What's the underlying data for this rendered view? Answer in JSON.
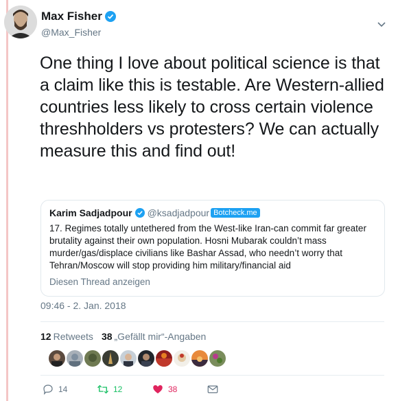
{
  "author": {
    "name": "Max Fisher",
    "handle": "@Max_Fisher"
  },
  "tweet": {
    "text": "One thing I love about political science is that a claim like this is testable. Are Western-allied countries less likely to cross certain violence threshholders vs protesters? We can actually measure this and find out!",
    "timestamp": "09:46 - 2. Jan. 2018"
  },
  "quoted": {
    "name": "Karim Sadjadpour",
    "handle": "@ksadjadpour",
    "badge": "Botcheck.me",
    "text": "17. Regimes totally untethered from the West-like Iran-can commit far greater brutality against their own population. Hosni Mubarak couldn’t mass murder/gas/displace civilians like Bashar Assad, who needn’t worry that Tehran/Moscow will stop providing him military/financial aid",
    "thread_link": "Diesen Thread anzeigen"
  },
  "stats": {
    "retweets_count": "12",
    "retweets_label": "Retweets",
    "likes_count": "38",
    "likes_label": "„Gefällt mir“-Angaben"
  },
  "actions": {
    "replies": "14",
    "retweets": "12",
    "likes": "38"
  },
  "colors": {
    "verified_blue": "#1da1f2",
    "retweet_green": "#17bf63",
    "like_red": "#e0245e",
    "muted_gray": "#657786"
  }
}
